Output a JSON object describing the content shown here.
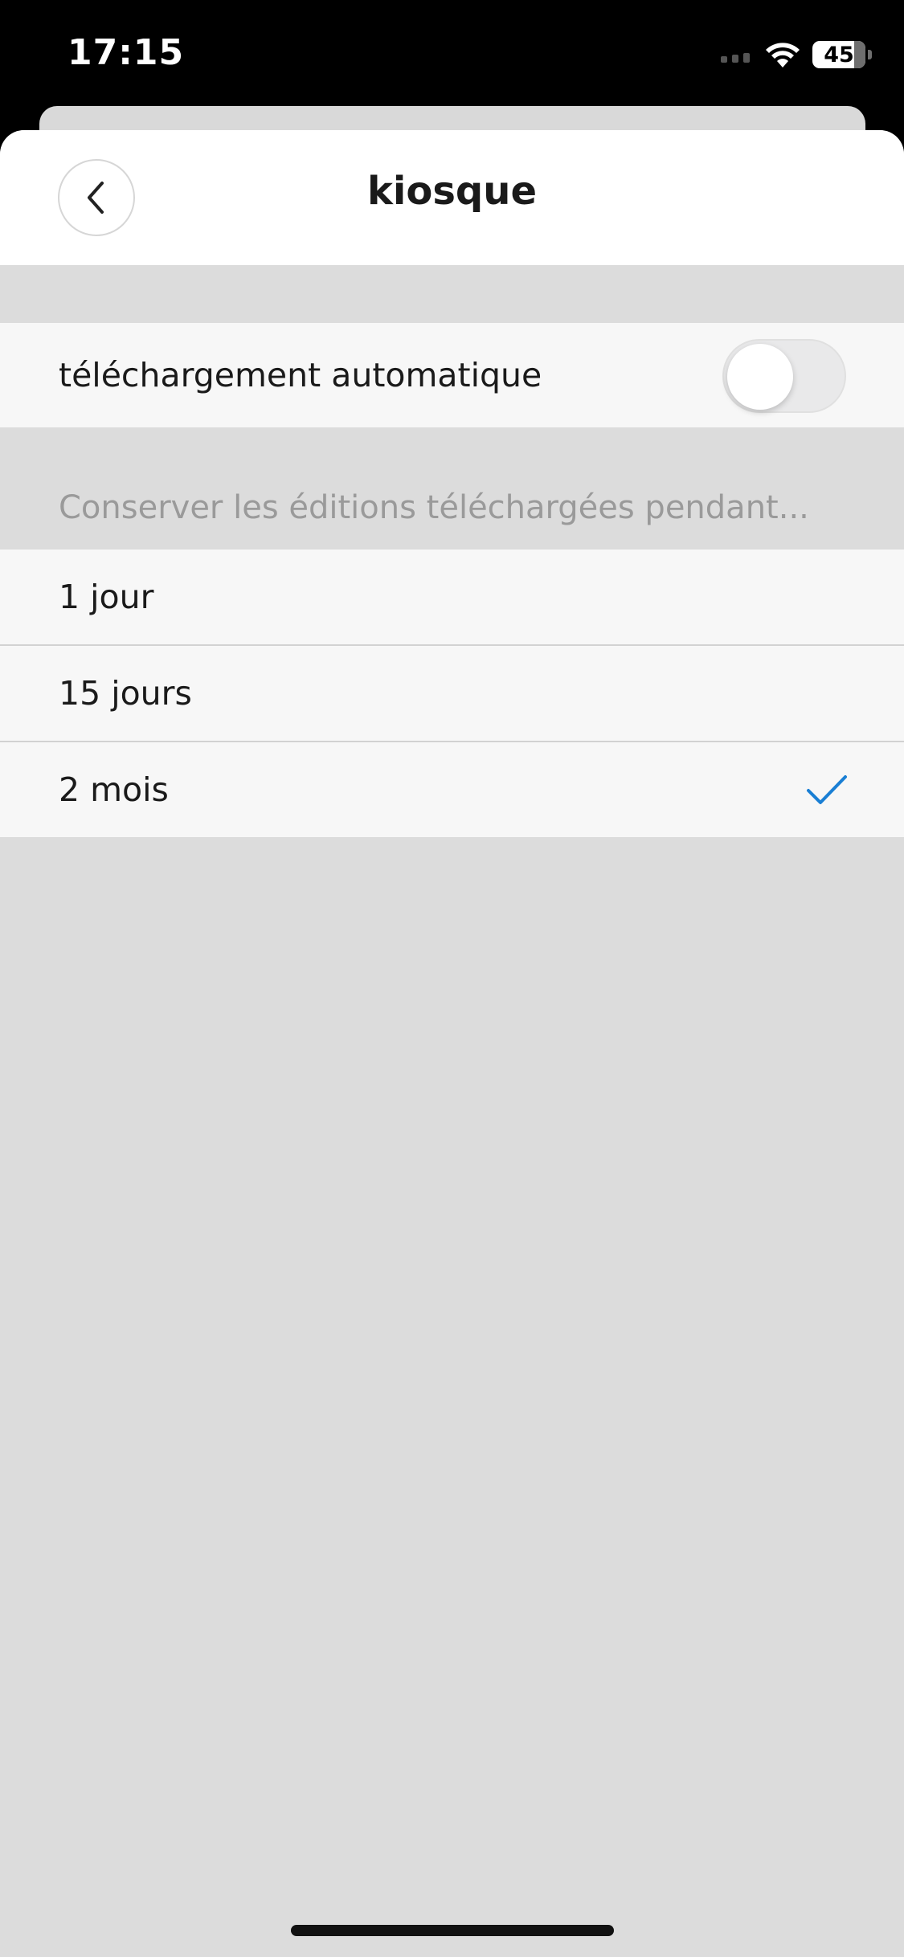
{
  "status_bar": {
    "time": "17:15",
    "battery_level": "45",
    "icons": [
      "signal-icon",
      "wifi-icon",
      "battery-icon"
    ]
  },
  "header": {
    "title": "kiosque",
    "back_icon": "chevron-left-icon"
  },
  "auto_download": {
    "label": "téléchargement automatique",
    "enabled": false
  },
  "retention": {
    "section_title": "Conserver les éditions téléchargées pendant...",
    "options": [
      {
        "label": "1 jour",
        "selected": false
      },
      {
        "label": "15 jours",
        "selected": false
      },
      {
        "label": "2 mois",
        "selected": true
      }
    ]
  },
  "colors": {
    "accent": "#1a7fd4",
    "background": "#dcdcdc",
    "row_background": "#f7f7f7",
    "section_text": "#9a9a9a"
  }
}
